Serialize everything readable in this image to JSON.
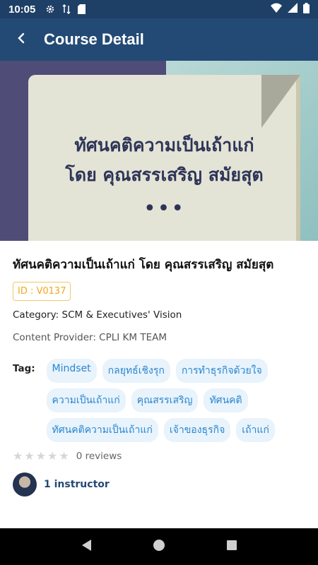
{
  "status_bar": {
    "time": "10:05",
    "icons": [
      "gear-icon",
      "data-arrows-icon",
      "sd-card-icon",
      "wifi-icon",
      "signal-icon",
      "battery-icon"
    ]
  },
  "app_bar": {
    "title": "Course Detail",
    "back_icon": "chevron-left-icon"
  },
  "banner": {
    "line1": "ทัศนคติความเป็นเถ้าแก่",
    "line2": "โดย คุณสรรเสริญ สมัยสุต",
    "dots": "•••"
  },
  "course": {
    "title": "ทัศนคติความเป็นเถ้าแก่ โดย คุณสรรเสริญ สมัยสุต",
    "id": "ID : V0137",
    "category": "Category: SCM & Executives' Vision",
    "provider": "Content Provider: CPLI KM TEAM",
    "tags_label": "Tag:",
    "tags": [
      "Mindset",
      "กลยุทธ์เชิงรุก",
      "การทำธุรกิจด้วยใจ",
      "ความเป็นเถ้าแก่",
      "คุณสรรเสริญ",
      "ทัศนคติ",
      "ทัศนคติความเป็นเถ้าแก่",
      "เจ้าของธุรกิจ",
      "เถ้าแก่"
    ],
    "rating_stars": 0,
    "reviews": "0 reviews",
    "instructor": "1 instructor"
  },
  "colors": {
    "app_bar": "#234a75",
    "status_bar": "#1e3f66",
    "tag_bg": "#e8f3fc",
    "tag_text": "#2a86cf",
    "id_badge": "#f0a81c"
  },
  "nav": {
    "back": "triangle-back-icon",
    "home": "circle-home-icon",
    "recents": "square-recents-icon"
  }
}
